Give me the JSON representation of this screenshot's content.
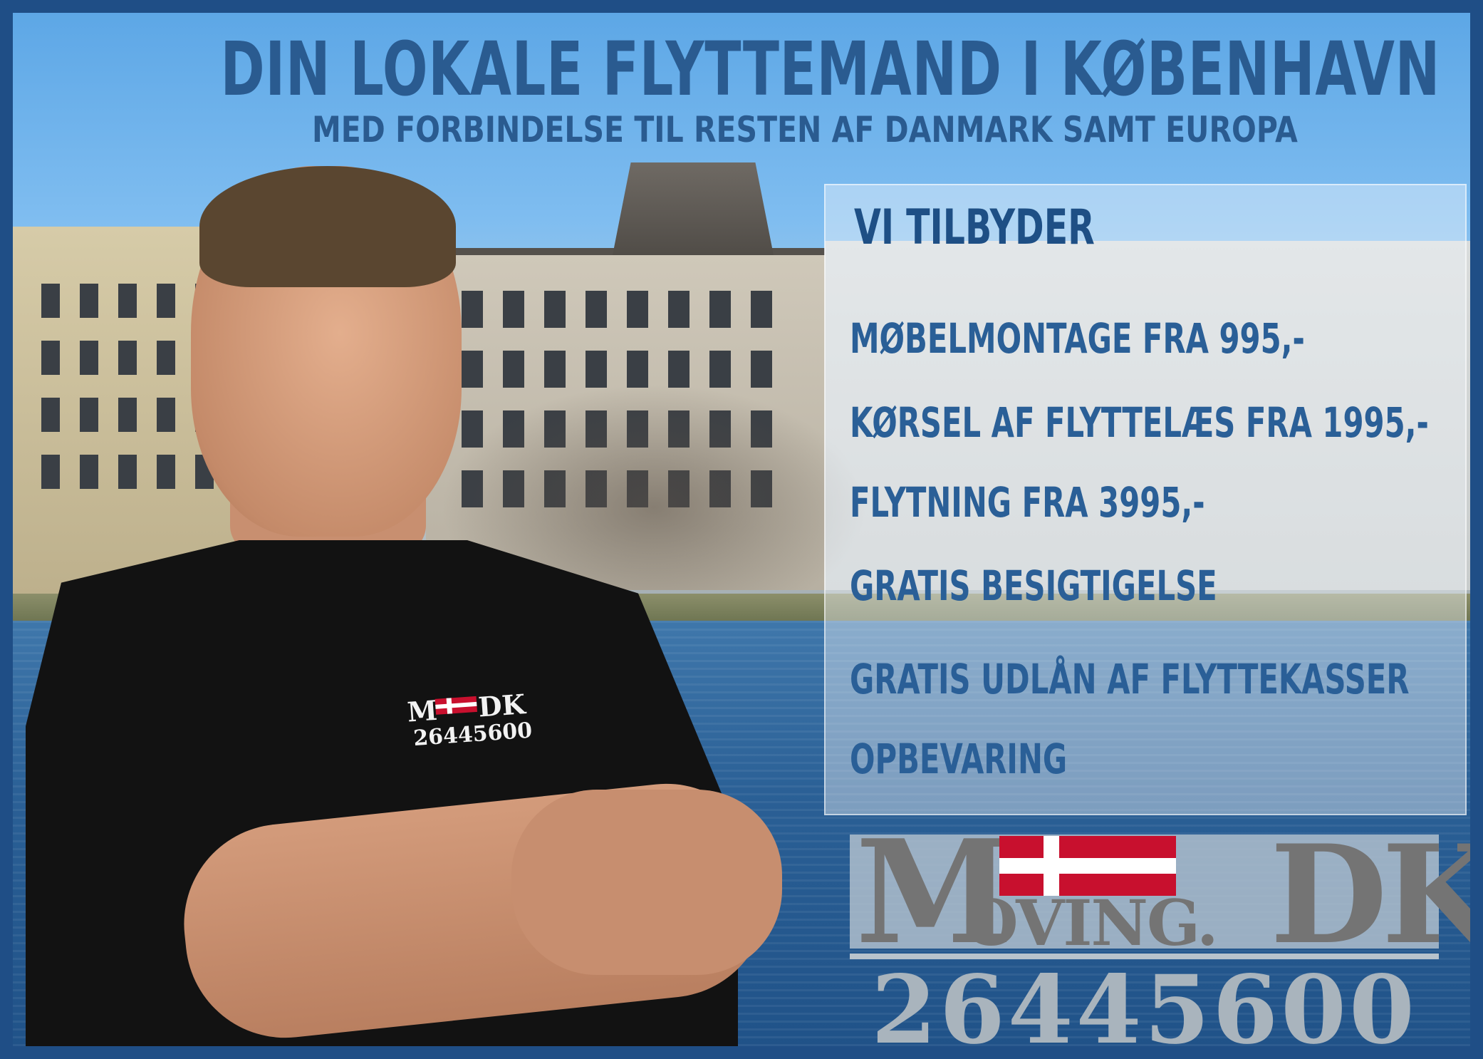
{
  "headline": {
    "title": "DIN LOKALE FLYTTEMAND I KØBENHAVN",
    "subtitle": "MED FORBINDELSE TIL RESTEN AF DANMARK SAMT EUROPA"
  },
  "offer": {
    "title": "VI TILBYDER",
    "items": [
      "MØBELMONTAGE FRA 995,-",
      "KØRSEL AF FLYTTELÆS FRA 1995,-",
      "FLYTNING FRA 3995,-",
      "GRATIS BESIGTIGELSE",
      "GRATIS UDLÅN AF FLYTTEKASSER",
      "OPBEVARING"
    ]
  },
  "logo": {
    "letter_m": "M",
    "letters_oving": "OVING.",
    "letters_dk": "DK",
    "phone": "26445600",
    "flag_icon": "danish-flag-icon"
  },
  "shirt_logo": {
    "letter_m": "M",
    "letters_dk": "DK",
    "phone": "26445600"
  },
  "colors": {
    "frame": "#1f4e86",
    "headline_text": "#2a5b90",
    "flag_red": "#c8102e",
    "logo_grey": "#747474"
  }
}
